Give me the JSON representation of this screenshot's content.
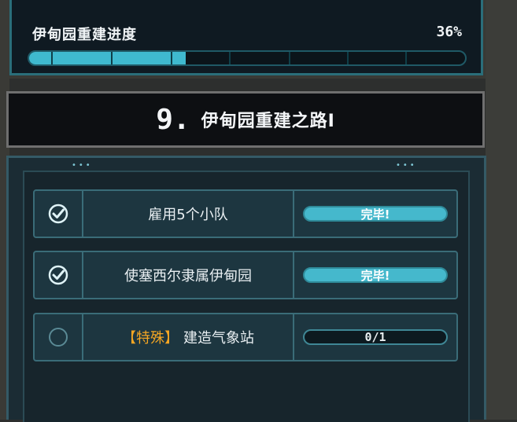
{
  "progress": {
    "title": "伊甸园重建进度",
    "percent_text": "36%",
    "fraction": 0.36
  },
  "chapter": {
    "number": "9.",
    "title": "伊甸园重建之路I"
  },
  "panel": {
    "dots_left": "•••",
    "dots_right": "•••"
  },
  "tasks": [
    {
      "completed": true,
      "tag": "",
      "label": "雇用5个小队",
      "status": "完毕!"
    },
    {
      "completed": true,
      "tag": "",
      "label": "使塞西尔隶属伊甸园",
      "status": "完毕!"
    },
    {
      "completed": false,
      "tag": "【特殊】",
      "label": "建造气象站",
      "status": "0/1"
    }
  ],
  "colors": {
    "accent": "#45b8cc",
    "special_tag": "#f5a623",
    "panel_bg": "#1d3640"
  },
  "icons": {
    "completed": "check-circle-icon",
    "pending": "empty-circle-icon"
  }
}
